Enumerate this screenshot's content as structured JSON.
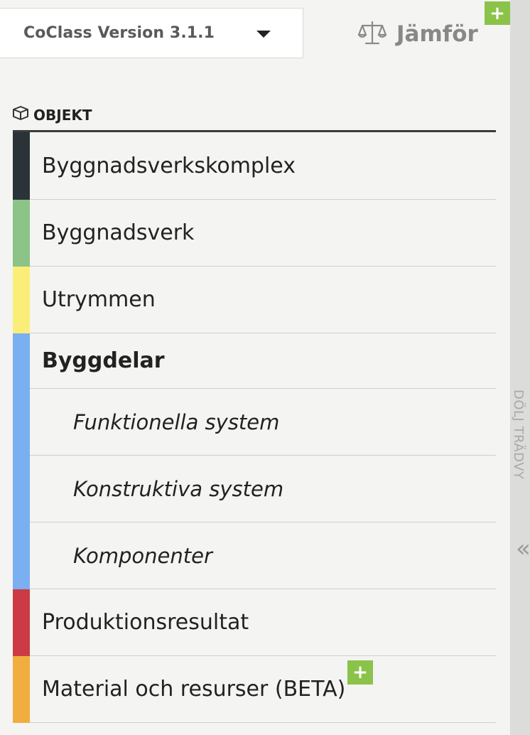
{
  "version_select": {
    "label": "CoClass Version 3.1.1"
  },
  "compare": {
    "label": "Jämför",
    "badge": "+"
  },
  "section": {
    "title": "OBJEKT"
  },
  "items": [
    {
      "label": "Byggnadsverkskomplex",
      "color": "#2b3338",
      "level": 0,
      "bold": false
    },
    {
      "label": "Byggnadsverk",
      "color": "#8cc386",
      "level": 0,
      "bold": false
    },
    {
      "label": "Utrymmen",
      "color": "#fbee78",
      "level": 0,
      "bold": false
    },
    {
      "label": "Byggdelar",
      "color": "#7aaff2",
      "level": 0,
      "bold": true
    },
    {
      "label": "Funktionella system",
      "color": "#7aaff2",
      "level": 1,
      "bold": false
    },
    {
      "label": "Konstruktiva system",
      "color": "#7aaff2",
      "level": 1,
      "bold": false
    },
    {
      "label": "Komponenter",
      "color": "#7aaff2",
      "level": 1,
      "bold": false
    },
    {
      "label": "Produktionsresultat",
      "color": "#cc3b45",
      "level": 0,
      "bold": false
    },
    {
      "label": "Material och resurser (BETA)",
      "color": "#f2ad3f",
      "level": 0,
      "bold": false,
      "badge": "+"
    }
  ],
  "sidebar_toggle": {
    "label": "DÖLJ TRÄDVY",
    "icon": "double-chevron-left-icon"
  }
}
